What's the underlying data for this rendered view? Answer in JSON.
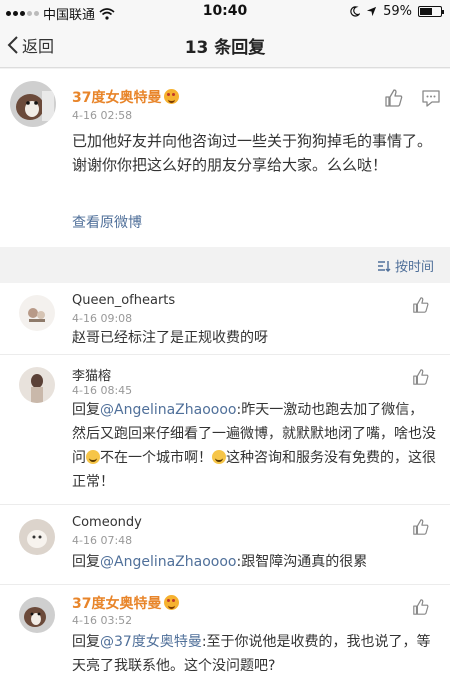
{
  "status_bar": {
    "carrier": "中国联通",
    "time": "10:40",
    "battery": "59%",
    "battery_level": 0.59
  },
  "nav": {
    "back_label": "返回",
    "title": "13 条回复"
  },
  "original_post": {
    "username": "37度女奥特曼",
    "time": "4-16 02:58",
    "content": "已加他好友并向他咨询过一些关于狗狗掉毛的事情了。谢谢你你把这么好的朋友分享给大家。么么哒！",
    "view_original": "查看原微博"
  },
  "sort": {
    "label": "按时间"
  },
  "replies": [
    {
      "username": "Queen_ofhearts",
      "time": "4-16 09:08",
      "content": "赵哥已经标注了是正规收费的呀"
    },
    {
      "username": "李猫榕",
      "time": "4-16 08:45",
      "prefix": "回复",
      "mention": "@AngelinaZhaoooo",
      "content1": ":昨天一激动也跑去加了微信，然后又跑回来仔细看了一遍微博，就默默地闭了嘴，啥也没问",
      "content2": "不在一个城市啊！",
      "content3": "这种咨询和服务没有免费的，这很正常！"
    },
    {
      "username": "Comeondy",
      "time": "4-16 07:48",
      "prefix": "回复",
      "mention": "@AngelinaZhaoooo",
      "content": ":跟智障沟通真的很累"
    },
    {
      "username": "37度女奥特曼",
      "time": "4-16 03:52",
      "prefix": "回复",
      "mention": "@37度女奥特曼",
      "content": ":至于你说他是收费的，我也说了，等天亮了我联系他。这个没问题吧?"
    }
  ],
  "icons": [
    "wifi-icon",
    "location-icon",
    "moon-icon",
    "back-chevron-icon",
    "like-icon",
    "comment-icon",
    "sort-icon"
  ],
  "colors": {
    "orange_name": "#e8852a",
    "link_blue": "#50709a",
    "bg": "#f2f2f2"
  }
}
